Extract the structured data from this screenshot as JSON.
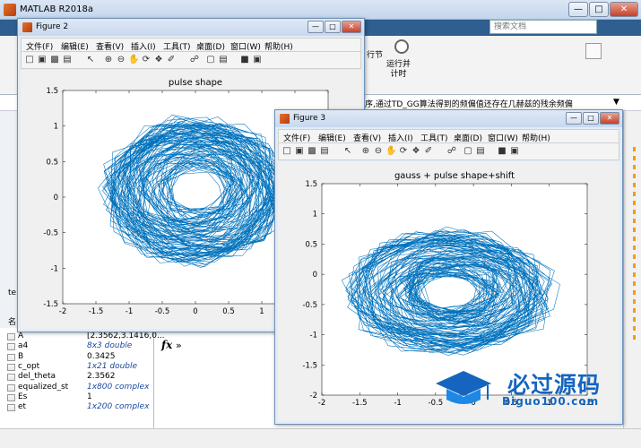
{
  "main_window": {
    "title": "MATLAB R2018a",
    "search_placeholder": "搜索文档",
    "ribbon_btn_1": "行节",
    "ribbon_btn_2": "运行并\n计时",
    "path_text": "序,通过TD_GG算法得到的频偏值还存在几赫兹的残余频偏",
    "cmd_arrows": "»",
    "fx_symbol": "fx",
    "left_tab": "te",
    "left_tab2": "名"
  },
  "workspace": {
    "rows": [
      {
        "name": "A",
        "value": "[2.3562,3.1416,0...",
        "italic": false
      },
      {
        "name": "a4",
        "value": "8x3 double",
        "italic": true
      },
      {
        "name": "B",
        "value": "0.3425",
        "italic": false
      },
      {
        "name": "c_opt",
        "value": "1x21 double",
        "italic": true
      },
      {
        "name": "del_theta",
        "value": "2.3562",
        "italic": false
      },
      {
        "name": "equalized_st",
        "value": "1x800 complex",
        "italic": true
      },
      {
        "name": "Es",
        "value": "1",
        "italic": false
      },
      {
        "name": "et",
        "value": "1x200 complex",
        "italic": true
      }
    ]
  },
  "fig_menu": [
    "文件(F)",
    "编辑(E)",
    "查看(V)",
    "插入(I)",
    "工具(T)",
    "桌面(D)",
    "窗口(W)",
    "帮助(H)"
  ],
  "figure2": {
    "title": "Figure 2"
  },
  "figure3": {
    "title": "Figure 3"
  },
  "logo": {
    "text": "必过源码",
    "url": "Biguo100.com"
  },
  "colors": {
    "plot_line": "#0072BD",
    "matlab_blue": "#2f5e91",
    "logo": "#1565c0"
  },
  "chart_data": [
    {
      "type": "line",
      "title": "pulse shape",
      "xlim": [
        -2,
        2
      ],
      "ylim": [
        -1.5,
        1.5
      ],
      "xticks": [
        -2,
        -1.5,
        -1,
        -0.5,
        0,
        0.5,
        1,
        1.5,
        2
      ],
      "yticks": [
        -1.5,
        -1,
        -0.5,
        0,
        0.5,
        1,
        1.5
      ],
      "shape": {
        "center": [
          0,
          0.1
        ],
        "rx": 1.4,
        "ry": 1.05,
        "segments": 800
      },
      "grid": false
    },
    {
      "type": "line",
      "title": "gauss + pulse shape+shift",
      "xlim": [
        -2,
        1.5
      ],
      "ylim": [
        -2,
        1.5
      ],
      "xticks": [
        -2,
        -1.5,
        -1,
        -0.5,
        0,
        0.5,
        1,
        1.5
      ],
      "yticks": [
        -2,
        -1.5,
        -1,
        -0.5,
        0,
        0.5,
        1,
        1.5
      ],
      "shape": {
        "center": [
          -0.3,
          -0.3
        ],
        "rx": 1.4,
        "ry": 1.05,
        "segments": 800
      },
      "grid": false
    }
  ]
}
